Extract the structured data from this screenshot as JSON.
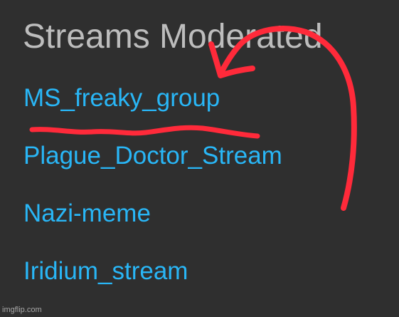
{
  "section": {
    "title": "Streams Moderated"
  },
  "streams": [
    {
      "label": "MS_freaky_group"
    },
    {
      "label": "Plague_Doctor_Stream"
    },
    {
      "label": "Nazi-meme"
    },
    {
      "label": "Iridium_stream"
    }
  ],
  "watermark": {
    "text": "imgflip.com"
  },
  "colors": {
    "background": "#2f2f2f",
    "heading": "#bdbdbd",
    "link": "#29b6f6",
    "annotation": "#ff2a3a"
  },
  "annotations": {
    "arrow": "red-hand-drawn-arrow",
    "underline": "red-hand-drawn-underline"
  }
}
